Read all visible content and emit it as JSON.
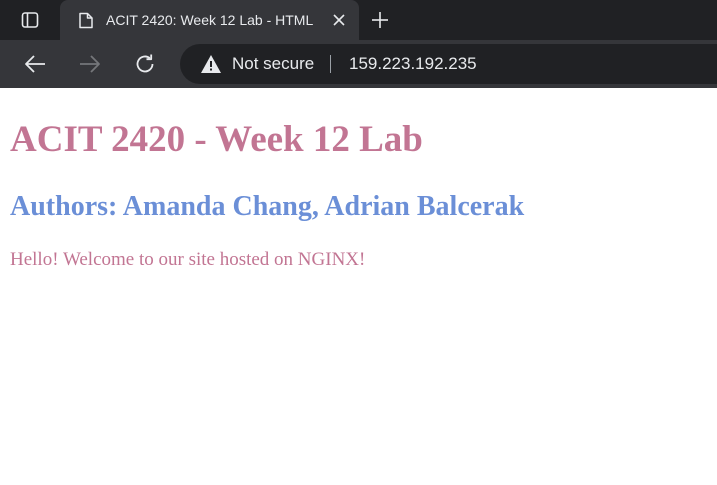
{
  "browser": {
    "tab": {
      "title": "ACIT 2420: Week 12 Lab - HTML",
      "favicon": "document-icon",
      "close_icon": "close-icon"
    },
    "tab_actions_icon": "tab-actions-icon",
    "new_tab_icon": "plus-icon",
    "nav": {
      "back_icon": "arrow-left-icon",
      "forward_icon": "arrow-right-icon",
      "reload_icon": "reload-icon"
    },
    "omnibox": {
      "security_icon": "warning-icon",
      "security_label": "Not secure",
      "url": "159.223.192.235"
    }
  },
  "page": {
    "heading": "ACIT 2420 - Week 12 Lab",
    "authors": "Authors: Amanda Chang, Adrian Balcerak",
    "body_text": "Hello! Welcome to our site hosted on NGINX!"
  },
  "colors": {
    "tabstrip_bg": "#202124",
    "toolbar_bg": "#35363a",
    "heading_color": "#c27593",
    "authors_color": "#6b8fd7",
    "text_color": "#c27593"
  }
}
